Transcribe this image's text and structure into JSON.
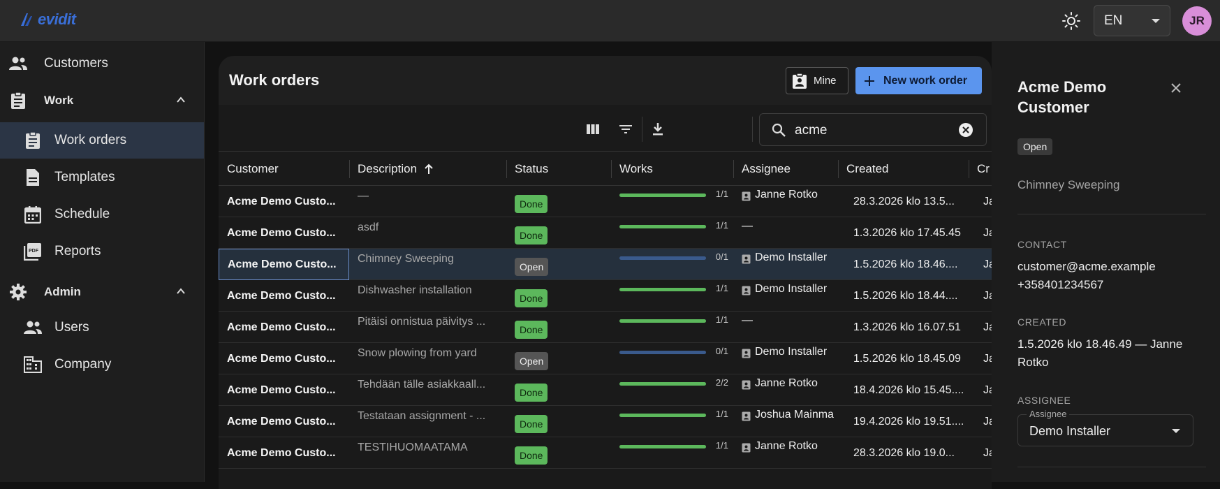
{
  "topbar": {
    "logo_text": "evidit",
    "language": "EN",
    "avatar_initials": "JR"
  },
  "sidebar": {
    "customers": "Customers",
    "work_group": "Work",
    "work_items": [
      "Work orders",
      "Templates",
      "Schedule",
      "Reports"
    ],
    "admin_group": "Admin",
    "admin_items": [
      "Users",
      "Company"
    ]
  },
  "main": {
    "title": "Work orders",
    "mine_label": "Mine",
    "new_label": "New work order",
    "search_value": "acme",
    "columns": [
      "Customer",
      "Description",
      "Status",
      "Works",
      "Assignee",
      "Created",
      "Cr"
    ],
    "rows": [
      {
        "customer": "Acme Demo Custo...",
        "description": "—",
        "status": "Done",
        "works": "1/1",
        "progress": 1.0,
        "assignee": "Janne Rotko",
        "created": "28.3.2026 klo 13.5...",
        "last": "Jan"
      },
      {
        "customer": "Acme Demo Custo...",
        "description": "asdf",
        "status": "Done",
        "works": "1/1",
        "progress": 1.0,
        "assignee": "—",
        "created": "1.3.2026 klo 17.45.45",
        "last": "Jan"
      },
      {
        "customer": "Acme Demo Custo...",
        "description": "Chimney Sweeping",
        "status": "Open",
        "works": "0/1",
        "progress": 0.0,
        "assignee": "Demo Installer",
        "created": "1.5.2026 klo 18.46....",
        "last": "Jan"
      },
      {
        "customer": "Acme Demo Custo...",
        "description": "Dishwasher installation",
        "status": "Done",
        "works": "1/1",
        "progress": 1.0,
        "assignee": "Demo Installer",
        "created": "1.5.2026 klo 18.44....",
        "last": "Jan"
      },
      {
        "customer": "Acme Demo Custo...",
        "description": "Pitäisi onnistua päivitys ...",
        "status": "Done",
        "works": "1/1",
        "progress": 1.0,
        "assignee": "—",
        "created": "1.3.2026 klo 16.07.51",
        "last": "Jan"
      },
      {
        "customer": "Acme Demo Custo...",
        "description": "Snow plowing from yard",
        "status": "Open",
        "works": "0/1",
        "progress": 0.0,
        "assignee": "Demo Installer",
        "created": "1.5.2026 klo 18.45.09",
        "last": "Jan"
      },
      {
        "customer": "Acme Demo Custo...",
        "description": "Tehdään tälle asiakkaall...",
        "status": "Done",
        "works": "2/2",
        "progress": 1.0,
        "assignee": "Janne Rotko",
        "created": "18.4.2026 klo 15.45....",
        "last": "Jan"
      },
      {
        "customer": "Acme Demo Custo...",
        "description": "Testataan assignment - ...",
        "status": "Done",
        "works": "1/1",
        "progress": 1.0,
        "assignee": "Joshua Mainma",
        "created": "19.4.2026 klo 19.51....",
        "last": "Jan"
      },
      {
        "customer": "Acme Demo Custo...",
        "description": "TESTIHUOMAATAMA",
        "status": "Done",
        "works": "1/1",
        "progress": 1.0,
        "assignee": "Janne Rotko",
        "created": "28.3.2026 klo 19.0...",
        "last": "Jan"
      }
    ]
  },
  "panel": {
    "title": "Acme Demo Customer",
    "status": "Open",
    "description": "Chimney Sweeping",
    "contact_heading": "CONTACT",
    "email": "customer@acme.example",
    "phone": "+358401234567",
    "created_heading": "CREATED",
    "created_text": "1.5.2026 klo 18.46.49 — Janne Rotko",
    "assignee_heading": "ASSIGNEE",
    "assignee_legend": "Assignee",
    "assignee_value": "Demo Installer"
  },
  "colors": {
    "accent": "#5b95ee",
    "done": "#5cb85c",
    "progress_done": "#5cb85c",
    "progress_open": "#3a5a8c"
  }
}
